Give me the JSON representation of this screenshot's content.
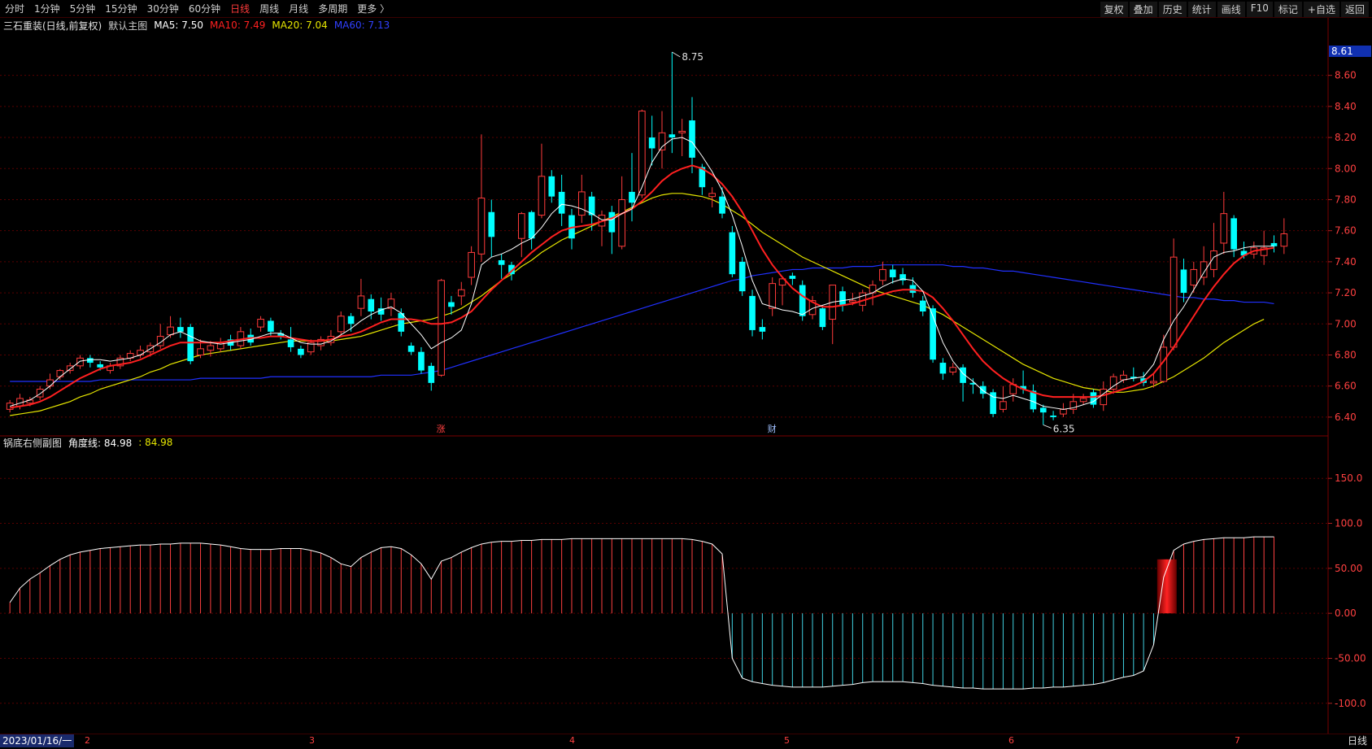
{
  "toolbar": {
    "timeframes": [
      "分时",
      "1分钟",
      "5分钟",
      "15分钟",
      "30分钟",
      "60分钟",
      "日线",
      "周线",
      "月线",
      "多周期",
      "更多 〉"
    ],
    "active": "日线",
    "tools": [
      "复权",
      "叠加",
      "历史",
      "统计",
      "画线",
      "F10",
      "+自选",
      "返回"
    ],
    "mark": "标记"
  },
  "main_info": {
    "title": "三石重装(日线,前复权)",
    "indicator": "默认主图",
    "ma5": "MA5: 7.50",
    "ma10": "MA10: 7.49",
    "ma20": "MA20: 7.04",
    "ma60": "MA60: 7.13"
  },
  "sub_info": {
    "title": "锅底右侧副图",
    "line1": "角度线: 84.98",
    "line2": ": 84.98"
  },
  "price_axis": [
    "8.60",
    "8.40",
    "8.20",
    "8.00",
    "7.80",
    "7.60",
    "7.40",
    "7.20",
    "7.00",
    "6.80",
    "6.60",
    "6.40"
  ],
  "current_price": "8.61",
  "sub_axis": [
    "150.0",
    "100.0",
    "50.00",
    "0.00",
    "-50.00",
    "-100.0"
  ],
  "annotations": {
    "high": "8.75",
    "low": "6.35",
    "zhang": "涨",
    "cai": "财"
  },
  "bottom": {
    "date": "2023/01/16/一",
    "period": "日线",
    "months": [
      "2",
      "3",
      "4",
      "5",
      "6",
      "7"
    ]
  },
  "colors": {
    "up": "#ff3b3b",
    "down": "#00ffff",
    "ma5": "#ffffff",
    "ma10": "#ff2020",
    "ma20": "#e6e600",
    "ma60": "#2030ff",
    "bg": "#000000"
  },
  "chart_data": {
    "type": "candlestick",
    "ylim": [
      6.3,
      8.75
    ],
    "candles": [
      [
        6.45,
        6.49,
        6.43,
        6.51
      ],
      [
        6.47,
        6.52,
        6.45,
        6.55
      ],
      [
        6.49,
        6.51,
        6.47,
        6.53
      ],
      [
        6.53,
        6.58,
        6.51,
        6.6
      ],
      [
        6.6,
        6.64,
        6.58,
        6.68
      ],
      [
        6.66,
        6.7,
        6.64,
        6.71
      ],
      [
        6.7,
        6.73,
        6.68,
        6.75
      ],
      [
        6.73,
        6.78,
        6.71,
        6.8
      ],
      [
        6.78,
        6.75,
        6.72,
        6.8
      ],
      [
        6.74,
        6.72,
        6.7,
        6.76
      ],
      [
        6.7,
        6.73,
        6.68,
        6.75
      ],
      [
        6.73,
        6.78,
        6.71,
        6.8
      ],
      [
        6.78,
        6.81,
        6.76,
        6.83
      ],
      [
        6.8,
        6.83,
        6.78,
        6.86
      ],
      [
        6.82,
        6.86,
        6.79,
        6.88
      ],
      [
        6.86,
        6.92,
        6.84,
        7.0
      ],
      [
        6.93,
        6.98,
        6.91,
        7.05
      ],
      [
        6.98,
        6.95,
        6.91,
        7.04
      ],
      [
        6.98,
        6.76,
        6.74,
        7.0
      ],
      [
        6.8,
        6.84,
        6.78,
        6.9
      ],
      [
        6.83,
        6.86,
        6.79,
        6.89
      ],
      [
        6.84,
        6.88,
        6.82,
        6.91
      ],
      [
        6.9,
        6.86,
        6.83,
        6.93
      ],
      [
        6.86,
        6.95,
        6.84,
        6.98
      ],
      [
        6.93,
        6.88,
        6.86,
        6.97
      ],
      [
        6.98,
        7.03,
        6.95,
        7.05
      ],
      [
        7.02,
        6.95,
        6.92,
        7.04
      ],
      [
        6.94,
        6.92,
        6.9,
        6.96
      ],
      [
        6.9,
        6.85,
        6.82,
        6.98
      ],
      [
        6.84,
        6.8,
        6.78,
        6.86
      ],
      [
        6.82,
        6.88,
        6.8,
        6.9
      ],
      [
        6.86,
        6.9,
        6.83,
        6.92
      ],
      [
        6.88,
        6.92,
        6.86,
        6.96
      ],
      [
        6.95,
        7.05,
        6.93,
        7.08
      ],
      [
        7.05,
        7.0,
        6.95,
        7.07
      ],
      [
        7.1,
        7.18,
        7.05,
        7.29
      ],
      [
        7.16,
        7.08,
        7.03,
        7.19
      ],
      [
        7.1,
        7.06,
        7.02,
        7.17
      ],
      [
        7.1,
        7.16,
        7.05,
        7.2
      ],
      [
        7.07,
        6.95,
        6.92,
        7.1
      ],
      [
        6.86,
        6.82,
        6.8,
        6.88
      ],
      [
        6.82,
        6.7,
        6.68,
        6.85
      ],
      [
        6.73,
        6.62,
        6.57,
        6.75
      ],
      [
        6.67,
        7.28,
        6.66,
        7.29
      ],
      [
        7.14,
        7.11,
        7.06,
        7.18
      ],
      [
        7.18,
        7.22,
        7.12,
        7.27
      ],
      [
        7.3,
        7.46,
        7.25,
        7.5
      ],
      [
        7.45,
        7.81,
        7.4,
        8.22
      ],
      [
        7.72,
        7.56,
        7.43,
        7.8
      ],
      [
        7.41,
        7.38,
        7.29,
        7.45
      ],
      [
        7.38,
        7.32,
        7.28,
        7.4
      ],
      [
        7.55,
        7.71,
        7.43,
        7.72
      ],
      [
        7.72,
        7.55,
        7.48,
        7.73
      ],
      [
        7.7,
        7.95,
        7.68,
        8.16
      ],
      [
        7.95,
        7.82,
        7.78,
        7.99
      ],
      [
        7.85,
        7.71,
        7.63,
        7.96
      ],
      [
        7.7,
        7.55,
        7.48,
        7.74
      ],
      [
        7.7,
        7.85,
        7.65,
        7.96
      ],
      [
        7.82,
        7.7,
        7.6,
        7.85
      ],
      [
        7.63,
        7.7,
        7.5,
        7.73
      ],
      [
        7.72,
        7.59,
        7.45,
        7.76
      ],
      [
        7.5,
        7.8,
        7.48,
        7.95
      ],
      [
        7.85,
        7.78,
        7.66,
        8.1
      ],
      [
        7.83,
        8.37,
        7.81,
        8.38
      ],
      [
        8.2,
        8.13,
        8.02,
        8.34
      ],
      [
        8.12,
        8.23,
        8.0,
        8.37
      ],
      [
        8.22,
        8.2,
        8.1,
        8.75
      ],
      [
        8.23,
        8.24,
        8.08,
        8.32
      ],
      [
        8.31,
        8.07,
        7.97,
        8.46
      ],
      [
        8.01,
        7.88,
        7.83,
        8.03
      ],
      [
        7.82,
        7.84,
        7.75,
        7.88
      ],
      [
        7.82,
        7.71,
        7.68,
        7.88
      ],
      [
        7.59,
        7.32,
        7.3,
        7.63
      ],
      [
        7.4,
        7.21,
        7.18,
        7.43
      ],
      [
        7.18,
        6.96,
        6.92,
        7.22
      ],
      [
        6.98,
        6.95,
        6.9,
        7.03
      ],
      [
        7.1,
        7.26,
        7.05,
        7.3
      ],
      [
        7.25,
        7.29,
        7.12,
        7.3
      ],
      [
        7.31,
        7.29,
        7.25,
        7.33
      ],
      [
        7.25,
        7.05,
        7.02,
        7.28
      ],
      [
        7.06,
        7.15,
        7.03,
        7.18
      ],
      [
        7.1,
        6.98,
        6.96,
        7.12
      ],
      [
        7.03,
        7.25,
        6.87,
        7.25
      ],
      [
        7.21,
        7.12,
        7.08,
        7.24
      ],
      [
        7.14,
        7.15,
        7.12,
        7.2
      ],
      [
        7.12,
        7.2,
        7.08,
        7.22
      ],
      [
        7.2,
        7.25,
        7.12,
        7.28
      ],
      [
        7.28,
        7.35,
        7.25,
        7.4
      ],
      [
        7.35,
        7.3,
        7.26,
        7.38
      ],
      [
        7.32,
        7.28,
        7.25,
        7.36
      ],
      [
        7.25,
        7.2,
        7.17,
        7.3
      ],
      [
        7.15,
        7.08,
        7.05,
        7.18
      ],
      [
        7.1,
        6.77,
        6.75,
        7.12
      ],
      [
        6.75,
        6.68,
        6.64,
        6.78
      ],
      [
        6.69,
        6.72,
        6.67,
        6.75
      ],
      [
        6.72,
        6.62,
        6.5,
        6.74
      ],
      [
        6.62,
        6.61,
        6.55,
        6.65
      ],
      [
        6.6,
        6.55,
        6.52,
        6.63
      ],
      [
        6.56,
        6.42,
        6.4,
        6.58
      ],
      [
        6.45,
        6.5,
        6.43,
        6.6
      ],
      [
        6.55,
        6.61,
        6.5,
        6.65
      ],
      [
        6.6,
        6.58,
        6.55,
        6.7
      ],
      [
        6.57,
        6.45,
        6.43,
        6.61
      ],
      [
        6.46,
        6.43,
        6.35,
        6.48
      ],
      [
        6.41,
        6.4,
        6.38,
        6.44
      ],
      [
        6.42,
        6.45,
        6.4,
        6.49
      ],
      [
        6.45,
        6.5,
        6.42,
        6.55
      ],
      [
        6.5,
        6.52,
        6.48,
        6.55
      ],
      [
        6.56,
        6.48,
        6.46,
        6.58
      ],
      [
        6.48,
        6.58,
        6.44,
        6.63
      ],
      [
        6.58,
        6.66,
        6.55,
        6.68
      ],
      [
        6.64,
        6.67,
        6.62,
        6.7
      ],
      [
        6.66,
        6.65,
        6.63,
        6.72
      ],
      [
        6.65,
        6.62,
        6.6,
        6.69
      ],
      [
        6.62,
        6.63,
        6.59,
        6.68
      ],
      [
        6.63,
        6.85,
        6.62,
        6.93
      ],
      [
        6.85,
        7.43,
        6.83,
        7.55
      ],
      [
        7.35,
        7.2,
        7.14,
        7.42
      ],
      [
        7.25,
        7.35,
        7.2,
        7.4
      ],
      [
        7.3,
        7.4,
        7.25,
        7.5
      ],
      [
        7.35,
        7.47,
        7.3,
        7.65
      ],
      [
        7.52,
        7.71,
        7.45,
        7.85
      ],
      [
        7.68,
        7.48,
        7.43,
        7.7
      ],
      [
        7.47,
        7.44,
        7.42,
        7.53
      ],
      [
        7.45,
        7.49,
        7.42,
        7.53
      ],
      [
        7.44,
        7.49,
        7.38,
        7.6
      ],
      [
        7.52,
        7.5,
        7.46,
        7.57
      ],
      [
        7.5,
        7.58,
        7.45,
        7.68
      ]
    ],
    "ma5": [
      6.47,
      6.49,
      6.51,
      6.55,
      6.6,
      6.66,
      6.71,
      6.76,
      6.77,
      6.77,
      6.76,
      6.77,
      6.78,
      6.8,
      6.84,
      6.88,
      6.93,
      6.95,
      6.92,
      6.89,
      6.88,
      6.87,
      6.88,
      6.89,
      6.9,
      6.92,
      6.94,
      6.94,
      6.91,
      6.88,
      6.87,
      6.87,
      6.89,
      6.93,
      6.97,
      7.02,
      7.06,
      7.09,
      7.11,
      7.07,
      7.0,
      6.93,
      6.84,
      6.88,
      6.91,
      6.96,
      7.13,
      7.38,
      7.43,
      7.45,
      7.48,
      7.52,
      7.55,
      7.62,
      7.71,
      7.77,
      7.76,
      7.74,
      7.71,
      7.67,
      7.67,
      7.71,
      7.74,
      7.88,
      8.04,
      8.14,
      8.19,
      8.2,
      8.17,
      8.08,
      7.98,
      7.86,
      7.7,
      7.5,
      7.28,
      7.13,
      7.11,
      7.09,
      7.08,
      7.06,
      7.1,
      7.12,
      7.14,
      7.15,
      7.16,
      7.18,
      7.2,
      7.24,
      7.27,
      7.29,
      7.28,
      7.21,
      7.05,
      6.88,
      6.76,
      6.68,
      6.63,
      6.57,
      6.53,
      6.52,
      6.54,
      6.52,
      6.5,
      6.47,
      6.46,
      6.45,
      6.46,
      6.48,
      6.5,
      6.55,
      6.6,
      6.64,
      6.65,
      6.66,
      6.74,
      6.9,
      7.02,
      7.11,
      7.22,
      7.33,
      7.43,
      7.46,
      7.47,
      7.49,
      7.5,
      7.5,
      7.5
    ],
    "ma10": [
      6.46,
      6.47,
      6.48,
      6.5,
      6.53,
      6.57,
      6.61,
      6.65,
      6.68,
      6.71,
      6.73,
      6.74,
      6.75,
      6.77,
      6.8,
      6.83,
      6.86,
      6.88,
      6.88,
      6.88,
      6.88,
      6.88,
      6.89,
      6.9,
      6.91,
      6.91,
      6.92,
      6.92,
      6.91,
      6.9,
      6.89,
      6.89,
      6.9,
      6.92,
      6.93,
      6.95,
      6.98,
      7.01,
      7.03,
      7.03,
      7.03,
      7.02,
      7.0,
      7.0,
      7.01,
      7.04,
      7.08,
      7.15,
      7.22,
      7.28,
      7.34,
      7.4,
      7.46,
      7.51,
      7.56,
      7.6,
      7.62,
      7.63,
      7.64,
      7.66,
      7.68,
      7.71,
      7.74,
      7.79,
      7.85,
      7.92,
      7.97,
      8.0,
      8.02,
      8.0,
      7.96,
      7.9,
      7.82,
      7.72,
      7.6,
      7.48,
      7.38,
      7.3,
      7.23,
      7.18,
      7.14,
      7.11,
      7.11,
      7.12,
      7.13,
      7.15,
      7.17,
      7.19,
      7.21,
      7.22,
      7.22,
      7.21,
      7.17,
      7.1,
      7.02,
      6.93,
      6.84,
      6.76,
      6.7,
      6.65,
      6.61,
      6.58,
      6.56,
      6.54,
      6.53,
      6.53,
      6.53,
      6.53,
      6.53,
      6.54,
      6.56,
      6.58,
      6.6,
      6.63,
      6.68,
      6.76,
      6.85,
      6.95,
      7.05,
      7.15,
      7.24,
      7.32,
      7.39,
      7.44,
      7.47,
      7.48,
      7.49
    ],
    "ma20": [
      6.41,
      6.42,
      6.43,
      6.44,
      6.46,
      6.48,
      6.5,
      6.53,
      6.55,
      6.58,
      6.6,
      6.62,
      6.64,
      6.66,
      6.69,
      6.71,
      6.74,
      6.76,
      6.78,
      6.8,
      6.81,
      6.82,
      6.83,
      6.84,
      6.85,
      6.86,
      6.87,
      6.88,
      6.89,
      6.89,
      6.89,
      6.89,
      6.89,
      6.9,
      6.91,
      6.92,
      6.94,
      6.96,
      6.98,
      7.0,
      7.01,
      7.02,
      7.03,
      7.05,
      7.07,
      7.1,
      7.14,
      7.18,
      7.23,
      7.28,
      7.32,
      7.37,
      7.41,
      7.46,
      7.5,
      7.54,
      7.57,
      7.6,
      7.63,
      7.66,
      7.69,
      7.72,
      7.75,
      7.78,
      7.81,
      7.83,
      7.84,
      7.84,
      7.83,
      7.82,
      7.8,
      7.77,
      7.73,
      7.69,
      7.64,
      7.59,
      7.55,
      7.51,
      7.47,
      7.43,
      7.4,
      7.37,
      7.34,
      7.31,
      7.28,
      7.25,
      7.22,
      7.2,
      7.18,
      7.16,
      7.14,
      7.12,
      7.09,
      7.06,
      7.02,
      6.98,
      6.94,
      6.9,
      6.86,
      6.82,
      6.78,
      6.74,
      6.71,
      6.68,
      6.65,
      6.63,
      6.61,
      6.59,
      6.58,
      6.57,
      6.56,
      6.56,
      6.57,
      6.58,
      6.6,
      6.63,
      6.66,
      6.7,
      6.74,
      6.78,
      6.83,
      6.88,
      6.92,
      6.96,
      7.0,
      7.03
    ],
    "ma60": [
      6.63,
      6.63,
      6.63,
      6.63,
      6.63,
      6.63,
      6.63,
      6.63,
      6.63,
      6.64,
      6.64,
      6.64,
      6.64,
      6.64,
      6.64,
      6.64,
      6.64,
      6.64,
      6.64,
      6.65,
      6.65,
      6.65,
      6.65,
      6.65,
      6.65,
      6.65,
      6.66,
      6.66,
      6.66,
      6.66,
      6.66,
      6.66,
      6.66,
      6.66,
      6.66,
      6.66,
      6.66,
      6.67,
      6.67,
      6.67,
      6.67,
      6.68,
      6.69,
      6.7,
      6.72,
      6.74,
      6.76,
      6.78,
      6.8,
      6.82,
      6.84,
      6.86,
      6.88,
      6.9,
      6.92,
      6.94,
      6.96,
      6.98,
      7.0,
      7.02,
      7.04,
      7.06,
      7.08,
      7.1,
      7.12,
      7.14,
      7.16,
      7.18,
      7.2,
      7.22,
      7.24,
      7.26,
      7.28,
      7.29,
      7.31,
      7.32,
      7.33,
      7.34,
      7.35,
      7.35,
      7.36,
      7.36,
      7.36,
      7.36,
      7.37,
      7.37,
      7.37,
      7.38,
      7.38,
      7.38,
      7.38,
      7.38,
      7.38,
      7.38,
      7.37,
      7.37,
      7.36,
      7.36,
      7.35,
      7.34,
      7.34,
      7.33,
      7.32,
      7.31,
      7.3,
      7.29,
      7.28,
      7.27,
      7.26,
      7.25,
      7.24,
      7.23,
      7.22,
      7.21,
      7.2,
      7.19,
      7.18,
      7.17,
      7.17,
      7.16,
      7.16,
      7.15,
      7.15,
      7.14,
      7.14,
      7.14,
      7.13
    ],
    "angle": [
      12,
      28,
      38,
      45,
      53,
      60,
      65,
      68,
      70,
      72,
      73,
      74,
      75,
      76,
      76,
      77,
      77,
      78,
      78,
      78,
      77,
      76,
      74,
      72,
      71,
      71,
      71,
      72,
      72,
      72,
      70,
      67,
      62,
      55,
      52,
      62,
      68,
      73,
      74,
      72,
      65,
      55,
      38,
      58,
      62,
      68,
      73,
      77,
      79,
      80,
      80,
      81,
      81,
      82,
      82,
      82,
      83,
      83,
      83,
      83,
      83,
      83,
      83,
      83,
      83,
      83,
      83,
      83,
      82,
      80,
      77,
      66,
      -50,
      -72,
      -76,
      -78,
      -80,
      -81,
      -82,
      -82,
      -82,
      -82,
      -81,
      -80,
      -79,
      -77,
      -76,
      -76,
      -76,
      -76,
      -77,
      -78,
      -80,
      -81,
      -82,
      -83,
      -83,
      -84,
      -84,
      -84,
      -84,
      -84,
      -83,
      -83,
      -82,
      -82,
      -81,
      -80,
      -79,
      -77,
      -74,
      -71,
      -69,
      -64,
      -35,
      40,
      70,
      77,
      80,
      82,
      83,
      84,
      84,
      84,
      85,
      85,
      85
    ],
    "angle_ylim": [
      -130,
      180
    ]
  }
}
